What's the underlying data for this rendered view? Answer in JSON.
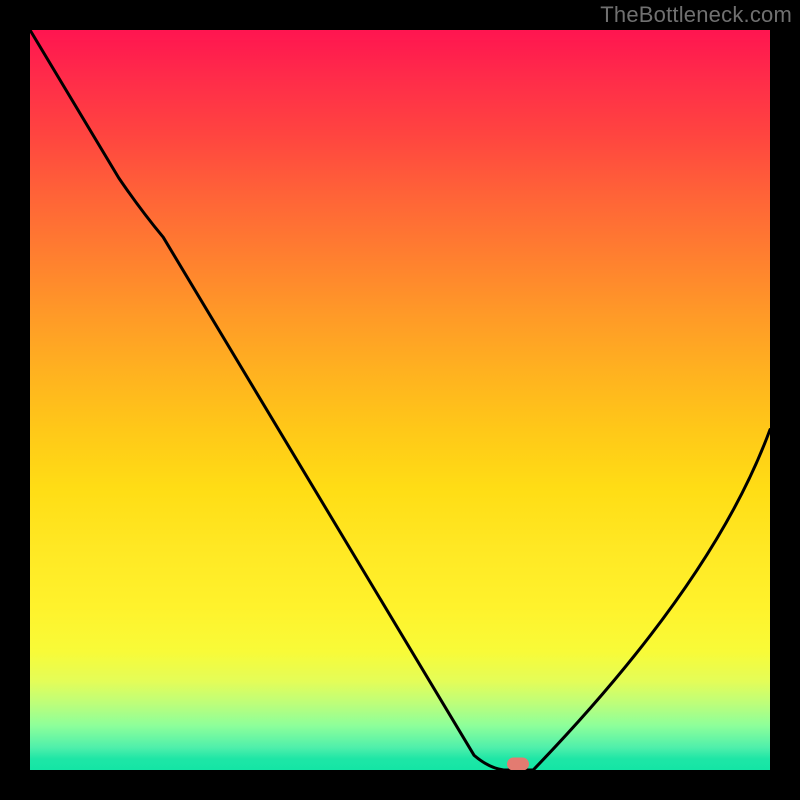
{
  "watermark": "TheBottleneck.com",
  "colors": {
    "page_bg": "#000000",
    "watermark": "#707070",
    "curve": "#000000",
    "marker": "#e37b71"
  },
  "chart_data": {
    "type": "line",
    "title": "",
    "xlabel": "",
    "ylabel": "",
    "xlim": [
      0,
      100
    ],
    "ylim": [
      0,
      100
    ],
    "grid": false,
    "series": [
      {
        "name": "bottleneck-curve",
        "x": [
          0,
          12,
          18,
          60,
          64,
          68,
          100
        ],
        "values": [
          100,
          80,
          72,
          2,
          0,
          0,
          46
        ]
      }
    ],
    "marker": {
      "x": 66,
      "y": 0.8
    },
    "gradient_stops": [
      {
        "pct": 0,
        "color": "#ff1550"
      },
      {
        "pct": 50,
        "color": "#ffc818"
      },
      {
        "pct": 80,
        "color": "#fff22c"
      },
      {
        "pct": 100,
        "color": "#14e5a5"
      }
    ]
  }
}
